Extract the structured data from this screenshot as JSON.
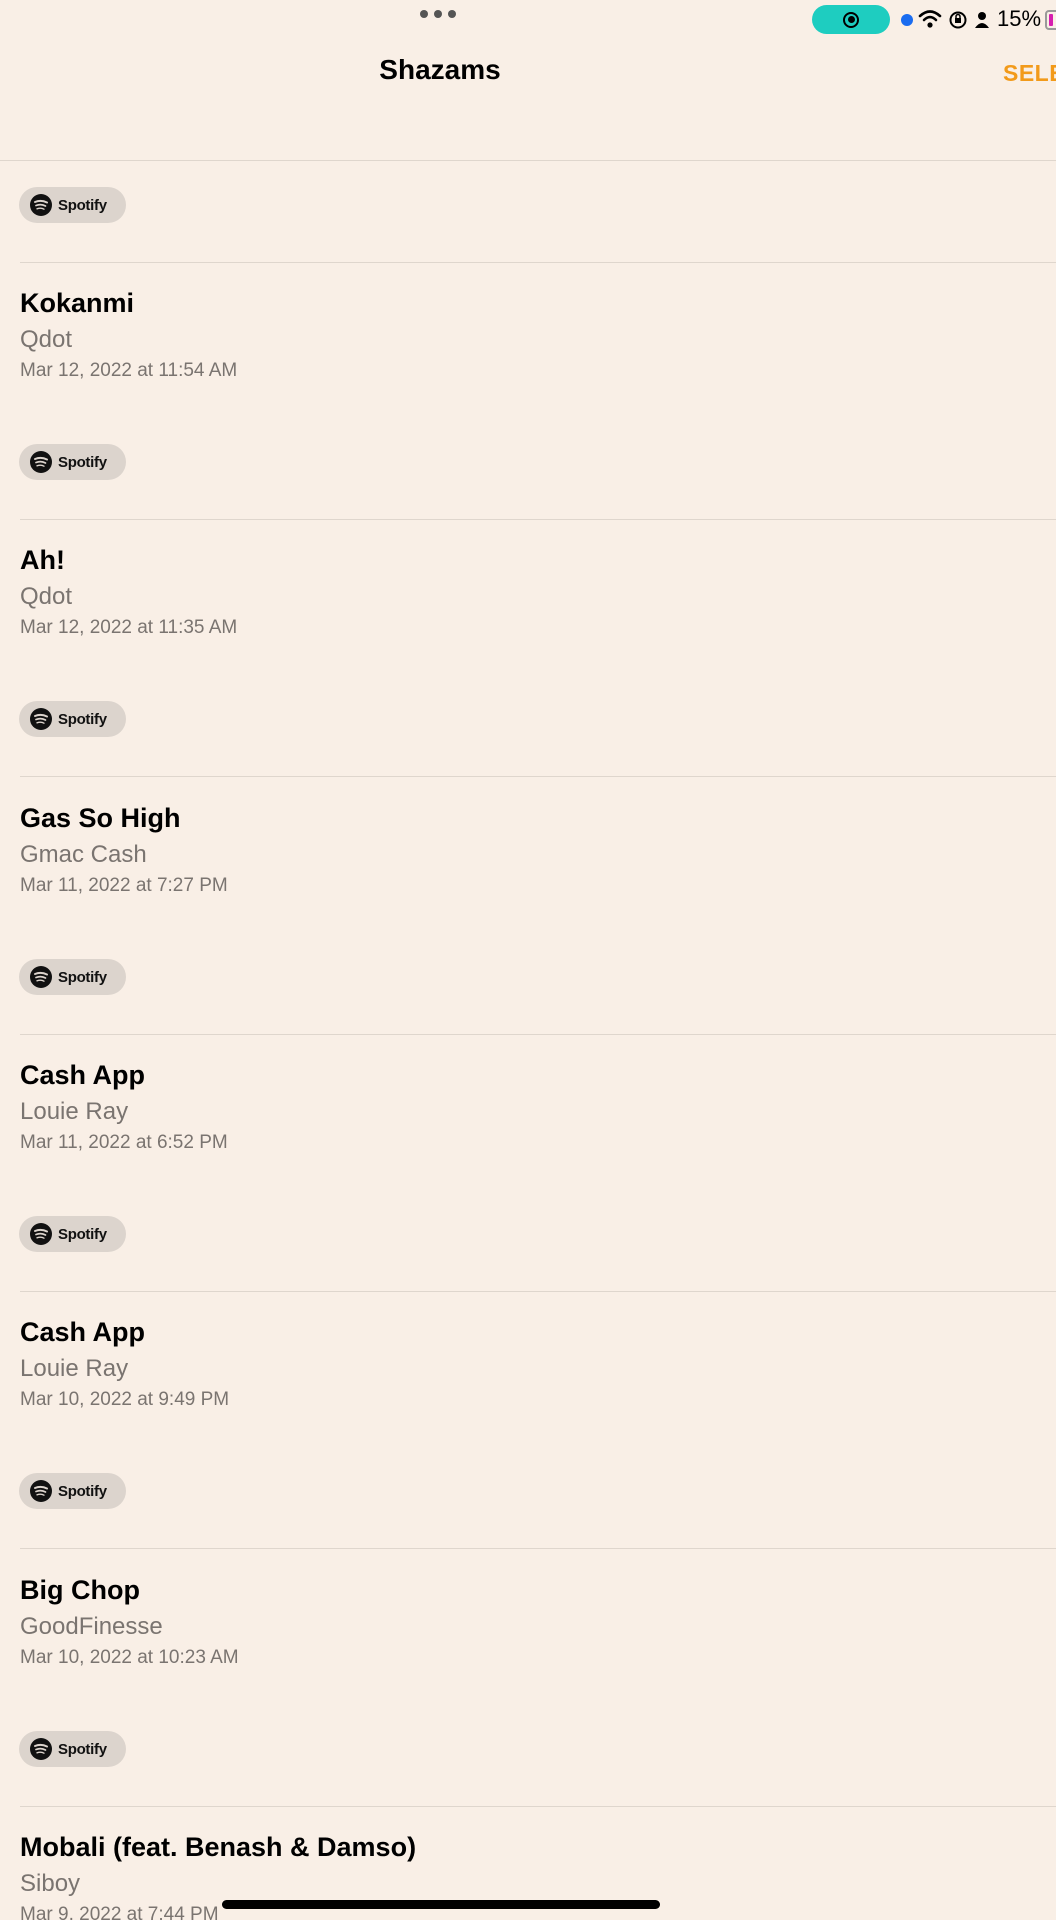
{
  "status_bar": {
    "battery_percent": "15%",
    "record_color": "#1ecdc0",
    "icons": [
      "record-icon",
      "wifi-icon",
      "orientation-lock-icon",
      "person-icon",
      "battery-icon"
    ]
  },
  "nav": {
    "title": "Shazams",
    "select_label": "SELE"
  },
  "spotify_label": "Spotify",
  "songs": [
    {
      "title": "Kokanmi",
      "artist": "Qdot",
      "date": "Mar 12, 2022 at 11:54 AM"
    },
    {
      "title": "Ah!",
      "artist": "Qdot",
      "date": "Mar 12, 2022 at 11:35 AM"
    },
    {
      "title": "Gas So High",
      "artist": "Gmac Cash",
      "date": "Mar 11, 2022 at 7:27 PM"
    },
    {
      "title": "Cash App",
      "artist": "Louie Ray",
      "date": "Mar 11, 2022 at 6:52 PM"
    },
    {
      "title": "Cash App",
      "artist": "Louie Ray",
      "date": "Mar 10, 2022 at 9:49 PM"
    },
    {
      "title": "Big Chop",
      "artist": "GoodFinesse",
      "date": "Mar 10, 2022 at 10:23 AM"
    },
    {
      "title": "Mobali (feat. Benash & Damso)",
      "artist": "Siboy",
      "date": "Mar 9, 2022 at 7:44 PM"
    }
  ],
  "colors": {
    "background": "#f9efe6",
    "accent": "#f29a1a",
    "secondary_text": "#7a7470"
  }
}
